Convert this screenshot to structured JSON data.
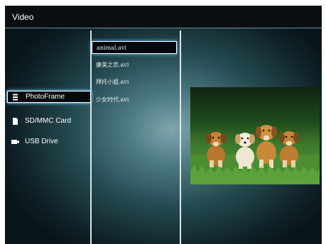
{
  "header": {
    "title": "Video"
  },
  "sources": [
    {
      "label": "PhotoFrame",
      "icon": "list-icon",
      "selected": true
    },
    {
      "label": "SD/MMC Card",
      "icon": "card-icon",
      "selected": false
    },
    {
      "label": "USB Drive",
      "icon": "usb-icon",
      "selected": false
    }
  ],
  "files": [
    {
      "name": "animal.avi",
      "selected": true
    },
    {
      "name": "康美之恋.avi",
      "selected": false
    },
    {
      "name": "拜托小姐.avi",
      "selected": false
    },
    {
      "name": "少女时代.avi",
      "selected": false
    }
  ],
  "preview": {
    "icon": "puppies-thumbnail"
  },
  "colors": {
    "accent_glow": "#5ec5ff",
    "header_bg": "#0a0f12"
  }
}
